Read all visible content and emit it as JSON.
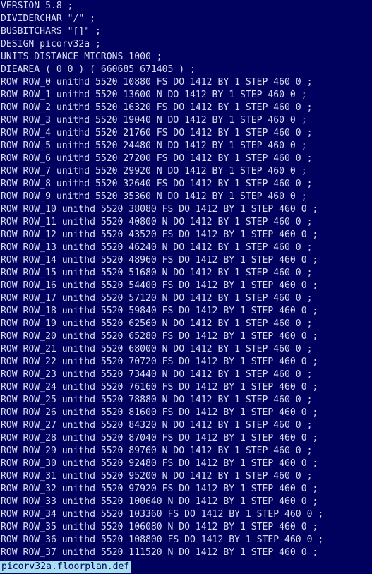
{
  "lines": [
    "VERSION 5.8 ;",
    "DIVIDERCHAR \"/\" ;",
    "BUSBITCHARS \"[]\" ;",
    "DESIGN picorv32a ;",
    "UNITS DISTANCE MICRONS 1000 ;",
    "DIEAREA ( 0 0 ) ( 660685 671405 ) ;",
    "ROW ROW_0 unithd 5520 10880 FS DO 1412 BY 1 STEP 460 0 ;",
    "ROW ROW_1 unithd 5520 13600 N DO 1412 BY 1 STEP 460 0 ;",
    "ROW ROW_2 unithd 5520 16320 FS DO 1412 BY 1 STEP 460 0 ;",
    "ROW ROW_3 unithd 5520 19040 N DO 1412 BY 1 STEP 460 0 ;",
    "ROW ROW_4 unithd 5520 21760 FS DO 1412 BY 1 STEP 460 0 ;",
    "ROW ROW_5 unithd 5520 24480 N DO 1412 BY 1 STEP 460 0 ;",
    "ROW ROW_6 unithd 5520 27200 FS DO 1412 BY 1 STEP 460 0 ;",
    "ROW ROW_7 unithd 5520 29920 N DO 1412 BY 1 STEP 460 0 ;",
    "ROW ROW_8 unithd 5520 32640 FS DO 1412 BY 1 STEP 460 0 ;",
    "ROW ROW_9 unithd 5520 35360 N DO 1412 BY 1 STEP 460 0 ;",
    "ROW ROW_10 unithd 5520 38080 FS DO 1412 BY 1 STEP 460 0 ;",
    "ROW ROW_11 unithd 5520 40800 N DO 1412 BY 1 STEP 460 0 ;",
    "ROW ROW_12 unithd 5520 43520 FS DO 1412 BY 1 STEP 460 0 ;",
    "ROW ROW_13 unithd 5520 46240 N DO 1412 BY 1 STEP 460 0 ;",
    "ROW ROW_14 unithd 5520 48960 FS DO 1412 BY 1 STEP 460 0 ;",
    "ROW ROW_15 unithd 5520 51680 N DO 1412 BY 1 STEP 460 0 ;",
    "ROW ROW_16 unithd 5520 54400 FS DO 1412 BY 1 STEP 460 0 ;",
    "ROW ROW_17 unithd 5520 57120 N DO 1412 BY 1 STEP 460 0 ;",
    "ROW ROW_18 unithd 5520 59840 FS DO 1412 BY 1 STEP 460 0 ;",
    "ROW ROW_19 unithd 5520 62560 N DO 1412 BY 1 STEP 460 0 ;",
    "ROW ROW_20 unithd 5520 65280 FS DO 1412 BY 1 STEP 460 0 ;",
    "ROW ROW_21 unithd 5520 68000 N DO 1412 BY 1 STEP 460 0 ;",
    "ROW ROW_22 unithd 5520 70720 FS DO 1412 BY 1 STEP 460 0 ;",
    "ROW ROW_23 unithd 5520 73440 N DO 1412 BY 1 STEP 460 0 ;",
    "ROW ROW_24 unithd 5520 76160 FS DO 1412 BY 1 STEP 460 0 ;",
    "ROW ROW_25 unithd 5520 78880 N DO 1412 BY 1 STEP 460 0 ;",
    "ROW ROW_26 unithd 5520 81600 FS DO 1412 BY 1 STEP 460 0 ;",
    "ROW ROW_27 unithd 5520 84320 N DO 1412 BY 1 STEP 460 0 ;",
    "ROW ROW_28 unithd 5520 87040 FS DO 1412 BY 1 STEP 460 0 ;",
    "ROW ROW_29 unithd 5520 89760 N DO 1412 BY 1 STEP 460 0 ;",
    "ROW ROW_30 unithd 5520 92480 FS DO 1412 BY 1 STEP 460 0 ;",
    "ROW ROW_31 unithd 5520 95200 N DO 1412 BY 1 STEP 460 0 ;",
    "ROW ROW_32 unithd 5520 97920 FS DO 1412 BY 1 STEP 460 0 ;",
    "ROW ROW_33 unithd 5520 100640 N DO 1412 BY 1 STEP 460 0 ;",
    "ROW ROW_34 unithd 5520 103360 FS DO 1412 BY 1 STEP 460 0 ;",
    "ROW ROW_35 unithd 5520 106080 N DO 1412 BY 1 STEP 460 0 ;",
    "ROW ROW_36 unithd 5520 108800 FS DO 1412 BY 1 STEP 460 0 ;",
    "ROW ROW_37 unithd 5520 111520 N DO 1412 BY 1 STEP 460 0 ;"
  ],
  "status_line": "picorv32a.floorplan.def",
  "colors": {
    "background": "#00005f",
    "text": "#d9dcf2",
    "status_bg": "#a8dff0",
    "status_text": "#00005f"
  }
}
